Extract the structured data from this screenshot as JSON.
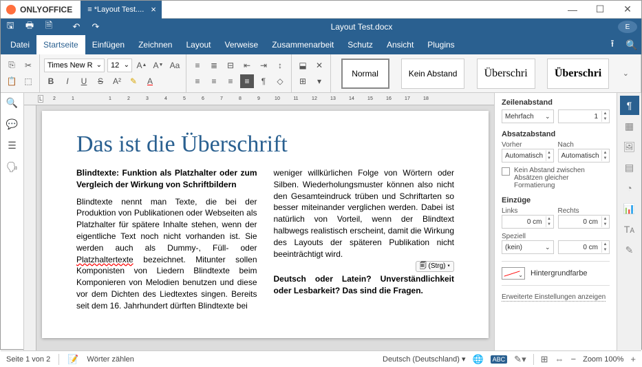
{
  "app": {
    "name": "ONLYOFFICE"
  },
  "tab": {
    "title": "*Layout Test...."
  },
  "doc_title": "Layout Test.docx",
  "user_initial": "E",
  "menu": {
    "file": "Datei",
    "home": "Startseite",
    "insert": "Einfügen",
    "draw": "Zeichnen",
    "layout": "Layout",
    "references": "Verweise",
    "collab": "Zusammenarbeit",
    "protect": "Schutz",
    "view": "Ansicht",
    "plugins": "Plugins"
  },
  "toolbar": {
    "font": "Times New R",
    "size": "12",
    "styles": {
      "normal": "Normal",
      "no_spacing": "Kein Abstand",
      "heading1": "Überschri",
      "heading1b": "Überschri"
    }
  },
  "document": {
    "heading": "Das ist die Überschrift",
    "sub1": "Blindtexte: Funktion als Platzhalter oder zum Vergleich der Wirkung von Schriftbildern",
    "p1a": "Blindtexte nennt man Texte, die bei der Produktion von Publikationen oder Webseiten als Platzhalter für spätere Inhalte stehen, wenn der eigentliche Text noch nicht vorhanden ist. Sie werden auch als Dummy-, Füll- oder ",
    "p1_wave": "Platzhaltertexte",
    "p1b": " bezeichnet. Mitunter sollen Komponisten von Liedern Blindtexte beim Komponieren von Melodien benutzen und diese vor dem Dichten des Liedtextes singen. Bereits seit dem 16. Jahrhundert dürften Blindtexte bei",
    "p2": "weniger willkürlichen Folge von Wörtern oder Silben. Wiederholungsmuster können also nicht den Gesamteindruck trüben und Schriftarten so besser miteinander verglichen werden. Dabei ist natürlich von Vorteil, wenn der Blindtext halbwegs realistisch erscheint, damit die Wirkung des Layouts der späteren Publikation nicht beeinträchtigt wird.",
    "chip": "(Strg)",
    "sub2": "Deutsch oder Latein? Unverständlichkeit oder Lesbarkeit? Das sind die Fragen."
  },
  "panel": {
    "line_spacing": "Zeilenabstand",
    "line_mode": "Mehrfach",
    "line_val": "1",
    "para_spacing": "Absatzabstand",
    "before": "Vorher",
    "after": "Nach",
    "auto": "Automatisch",
    "no_spacing_same": "Kein Abstand zwischen Absätzen gleicher Formatierung",
    "indent": "Einzüge",
    "left": "Links",
    "right": "Rechts",
    "zero_cm": "0 cm",
    "special": "Speziell",
    "none": "(kein)",
    "bg_color": "Hintergrundfarbe",
    "advanced": "Erweiterte Einstellungen anzeigen"
  },
  "status": {
    "page": "Seite 1 von 2",
    "wordcount": "Wörter zählen",
    "lang": "Deutsch (Deutschland)",
    "zoom": "Zoom 100%"
  }
}
